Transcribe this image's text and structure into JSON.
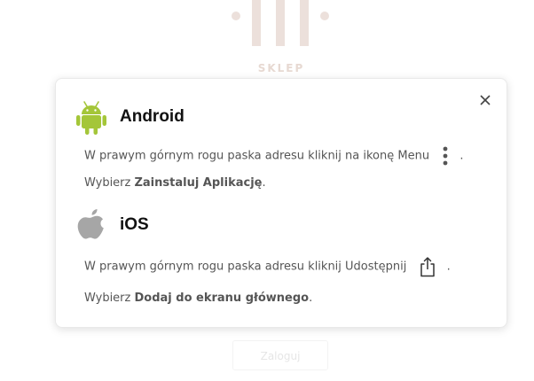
{
  "background": {
    "logo_icon": "store-logo-icon",
    "logo_text": "SKLEP",
    "button_label": "Zaloguj"
  },
  "modal": {
    "close_icon": "close-icon",
    "android": {
      "icon": "android-icon",
      "title": "Android",
      "step1_text": "W prawym górnym rogu paska adresu kliknij na ikonę Menu",
      "step1_icon": "kebab-menu-icon",
      "step1_suffix": ".",
      "step2_prefix": "Wybierz ",
      "step2_bold": "Zainstaluj Aplikację",
      "step2_suffix": "."
    },
    "ios": {
      "icon": "apple-icon",
      "title": "iOS",
      "step1_text": "W prawym górnym rogu paska adresu kliknij Udostępnij",
      "step1_icon": "share-icon",
      "step1_suffix": ".",
      "step2_prefix": "Wybierz ",
      "step2_bold": "Dodaj do ekranu głównego",
      "step2_suffix": "."
    }
  },
  "colors": {
    "android_green": "#a4c639",
    "apple_gray": "#a6a6a6",
    "logo_tint": "#e0cfc6"
  }
}
